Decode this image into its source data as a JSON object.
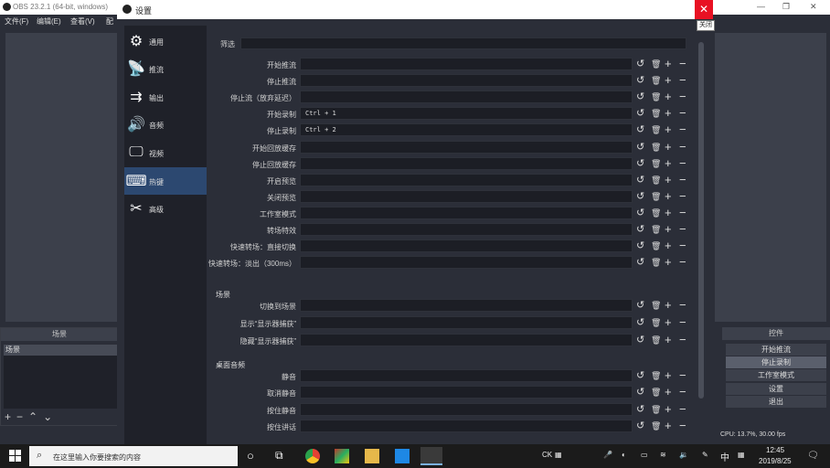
{
  "obs": {
    "title": "OBS 23.2.1 (64-bit, windows)",
    "menu": [
      "文件(F)",
      "编辑(E)",
      "查看(V)",
      "配"
    ],
    "scenes_panel_title": "场景",
    "scenes_sub": "场景",
    "controls_title": "控件",
    "controls": [
      "开始推流",
      "停止录制",
      "工作室模式",
      "设置",
      "退出"
    ],
    "status": "CPU: 13.7%, 30.00 fps"
  },
  "dialog": {
    "title": "设置",
    "close_tooltip": "关闭",
    "filter_label": "筛选",
    "sidebar": [
      {
        "label": "通用",
        "icon": "gear-icon"
      },
      {
        "label": "推流",
        "icon": "broadcast-icon"
      },
      {
        "label": "输出",
        "icon": "output-icon"
      },
      {
        "label": "音频",
        "icon": "speaker-icon"
      },
      {
        "label": "视频",
        "icon": "monitor-icon"
      },
      {
        "label": "热键",
        "icon": "keyboard-icon"
      },
      {
        "label": "高级",
        "icon": "tools-icon"
      }
    ],
    "active_sidebar": "热键",
    "hotkeys": [
      {
        "label": "开始推流",
        "value": ""
      },
      {
        "label": "停止推流",
        "value": ""
      },
      {
        "label": "停止流（放弃延迟）",
        "value": ""
      },
      {
        "label": "开始录制",
        "value": "Ctrl + 1"
      },
      {
        "label": "停止录制",
        "value": "Ctrl + 2"
      },
      {
        "label": "开始回放缓存",
        "value": ""
      },
      {
        "label": "停止回放缓存",
        "value": ""
      },
      {
        "label": "开启预览",
        "value": ""
      },
      {
        "label": "关闭预览",
        "value": ""
      },
      {
        "label": "工作室模式",
        "value": ""
      },
      {
        "label": "转场特效",
        "value": ""
      },
      {
        "label": "快速转场：直接切换",
        "value": ""
      },
      {
        "label": "快速转场：淡出（300ms）",
        "value": ""
      }
    ],
    "scene_section": "场景",
    "scene_hotkeys": [
      {
        "label": "切换到场景",
        "value": ""
      },
      {
        "label": "显示“显示器捕获”",
        "value": ""
      },
      {
        "label": "隐藏“显示器捕获”",
        "value": ""
      }
    ],
    "desktop_section": "桌面音频",
    "desktop_hotkeys": [
      {
        "label": "静音",
        "value": ""
      },
      {
        "label": "取消静音",
        "value": ""
      },
      {
        "label": "按住静音",
        "value": ""
      },
      {
        "label": "按住讲话",
        "value": ""
      }
    ],
    "row_actions": {
      "reset": "↺",
      "delete": "🗑",
      "add": "+",
      "remove": "−"
    }
  },
  "taskbar": {
    "search_placeholder": "在这里输入你要搜索的内容",
    "tray_ime_en": "CK",
    "tray_lang": "中",
    "time": "12:45",
    "date": "2019/8/25"
  }
}
